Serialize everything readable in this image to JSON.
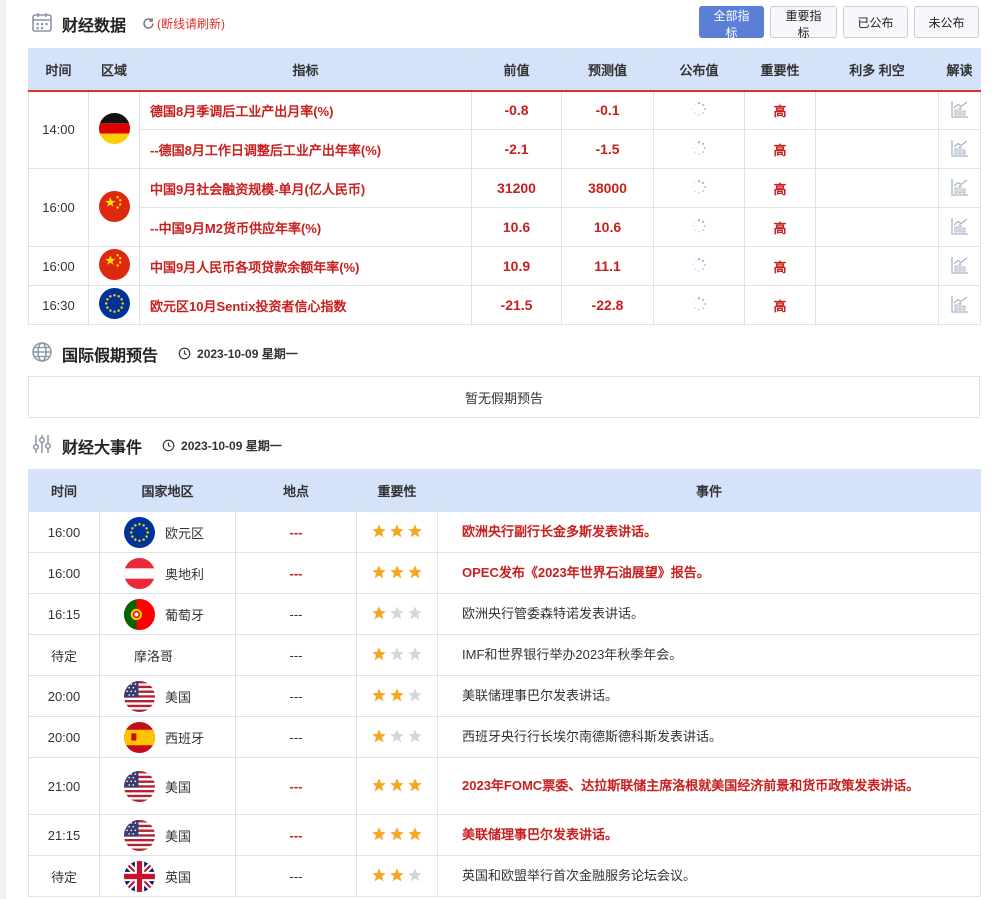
{
  "calendar": {
    "title": "财经数据",
    "refresh_label": "(断线请刷新)",
    "filters": [
      "全部指标",
      "重要指标",
      "已公布",
      "未公布"
    ],
    "columns": [
      "时间",
      "区域",
      "指标",
      "前值",
      "预测值",
      "公布值",
      "重要性",
      "利多 利空",
      "解读"
    ],
    "groups": [
      {
        "time": "14:00",
        "flag": "germany",
        "rows": [
          {
            "indicator": "德国8月季调后工业产出月率(%)",
            "prev": "-0.8",
            "forecast": "-0.1",
            "importance": "高"
          },
          {
            "indicator": "--德国8月工作日调整后工业产出年率(%)",
            "prev": "-2.1",
            "forecast": "-1.5",
            "importance": "高"
          }
        ]
      },
      {
        "time": "16:00",
        "flag": "china",
        "rows": [
          {
            "indicator": "中国9月社会融资规模-单月(亿人民币)",
            "prev": "31200",
            "forecast": "38000",
            "importance": "高"
          },
          {
            "indicator": "--中国9月M2货币供应年率(%)",
            "prev": "10.6",
            "forecast": "10.6",
            "importance": "高"
          }
        ]
      },
      {
        "time": "16:00",
        "flag": "china",
        "rows": [
          {
            "indicator": "中国9月人民币各项贷款余额年率(%)",
            "prev": "10.9",
            "forecast": "11.1",
            "importance": "高"
          }
        ]
      },
      {
        "time": "16:30",
        "flag": "eu",
        "rows": [
          {
            "indicator": "欧元区10月Sentix投资者信心指数",
            "prev": "-21.5",
            "forecast": "-22.8",
            "importance": "高"
          }
        ]
      }
    ]
  },
  "holidays": {
    "title": "国际假期预告",
    "date": "2023-10-09 星期一",
    "empty_text": "暂无假期预告"
  },
  "events": {
    "title": "财经大事件",
    "date": "2023-10-09 星期一",
    "columns": [
      "时间",
      "国家地区",
      "地点",
      "重要性",
      "事件"
    ],
    "rows": [
      {
        "time": "16:00",
        "flag": "eu",
        "country": "欧元区",
        "location": "---",
        "stars": 3,
        "event": "欧洲央行副行长金多斯发表讲话。",
        "high": true
      },
      {
        "time": "16:00",
        "flag": "austria",
        "country": "奥地利",
        "location": "---",
        "stars": 3,
        "event": "OPEC发布《2023年世界石油展望》报告。",
        "high": true
      },
      {
        "time": "16:15",
        "flag": "portugal",
        "country": "葡萄牙",
        "location": "---",
        "stars": 1,
        "event": "欧洲央行管委森特诺发表讲话。",
        "high": false
      },
      {
        "time": "待定",
        "flag": "",
        "country": "摩洛哥",
        "location": "---",
        "stars": 1,
        "event": "IMF和世界银行举办2023年秋季年会。",
        "high": false
      },
      {
        "time": "20:00",
        "flag": "usa",
        "country": "美国",
        "location": "---",
        "stars": 2,
        "event": "美联储理事巴尔发表讲话。",
        "high": false
      },
      {
        "time": "20:00",
        "flag": "spain",
        "country": "西班牙",
        "location": "---",
        "stars": 1,
        "event": "西班牙央行行长埃尔南德斯德科斯发表讲话。",
        "high": false
      },
      {
        "time": "21:00",
        "flag": "usa",
        "country": "美国",
        "location": "---",
        "stars": 3,
        "event": "2023年FOMC票委、达拉斯联储主席洛根就美国经济前景和货币政策发表讲话。",
        "high": true
      },
      {
        "time": "21:15",
        "flag": "usa",
        "country": "美国",
        "location": "---",
        "stars": 3,
        "event": "美联储理事巴尔发表讲话。",
        "high": true
      },
      {
        "time": "待定",
        "flag": "uk",
        "country": "英国",
        "location": "---",
        "stars": 2,
        "event": "英国和欧盟举行首次金融服务论坛会议。",
        "high": false
      }
    ]
  },
  "colors": {
    "accent": "#e0302a",
    "header_bg": "#d5e3fa",
    "active_filter": "#5b7fd6",
    "star_on": "#f5a623",
    "star_off": "#d3d6db"
  }
}
